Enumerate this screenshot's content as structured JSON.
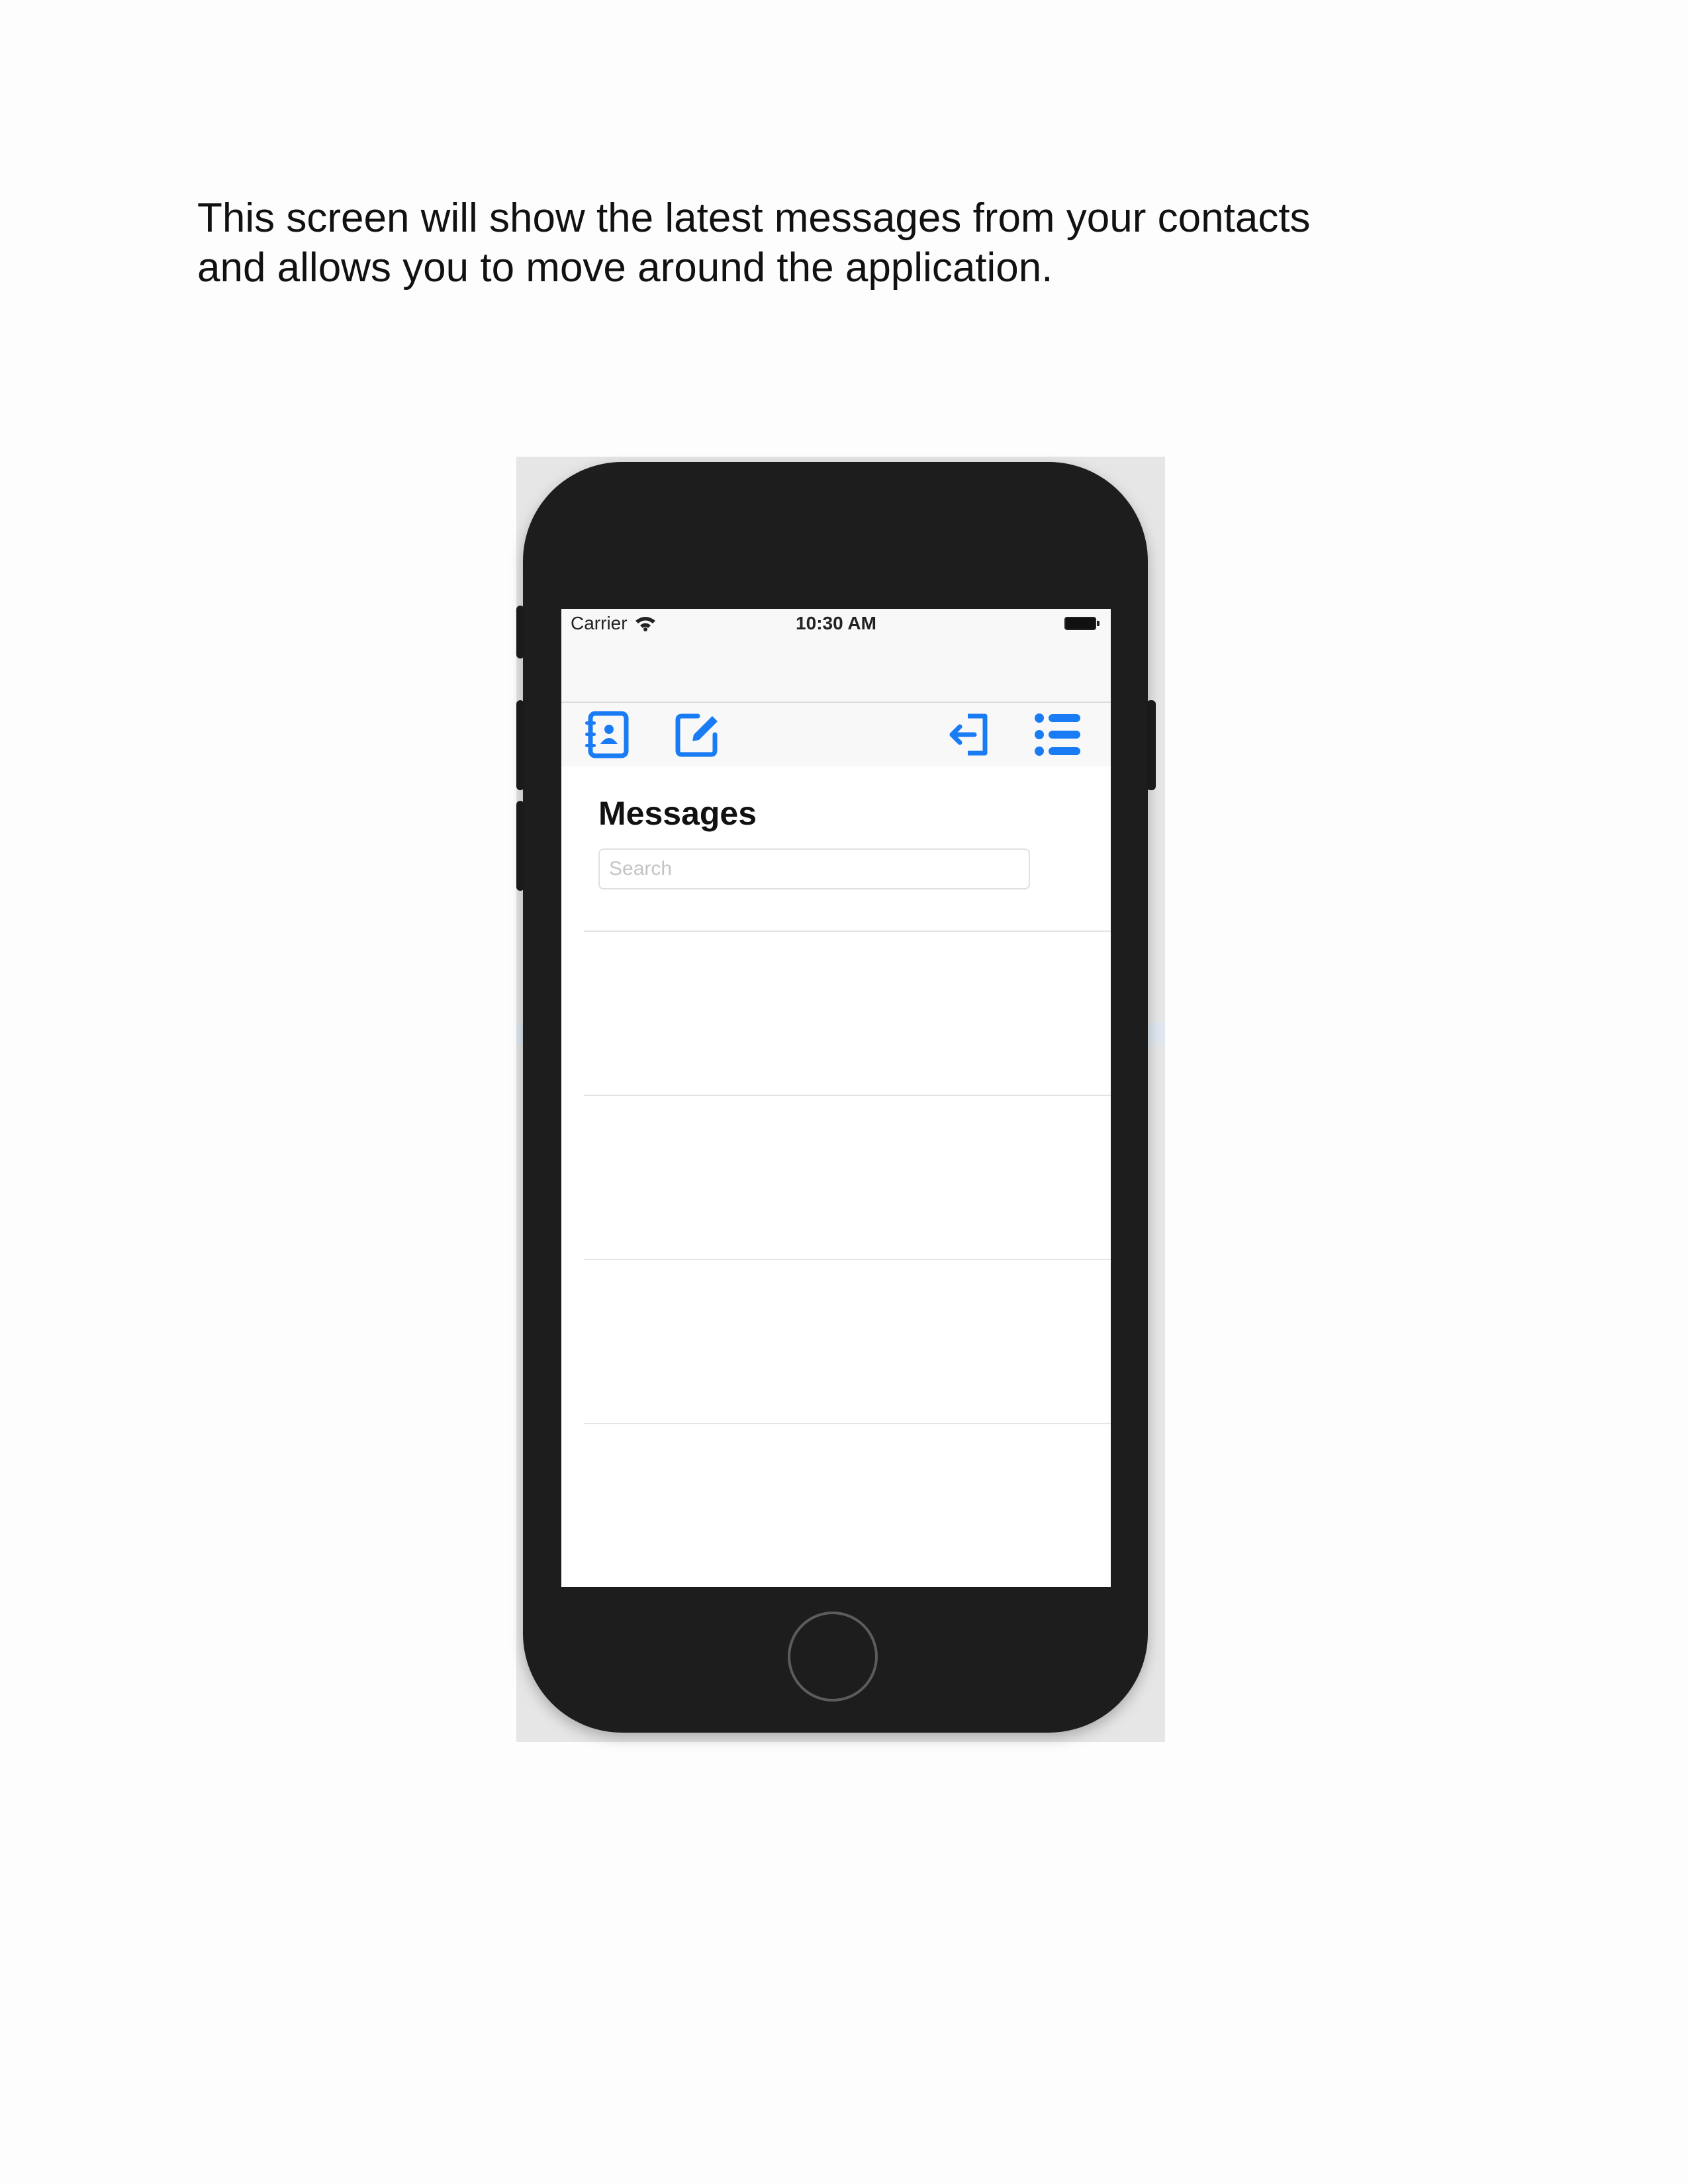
{
  "intro": {
    "line1": "This screen will show the latest messages from your contacts",
    "line2": "and allows you to move around the application."
  },
  "status_bar": {
    "carrier": "Carrier",
    "time": "10:30 AM",
    "battery_level": 1.0
  },
  "toolbar": {
    "left_buttons": [
      "contacts-book-icon",
      "compose-icon"
    ],
    "right_buttons": [
      "logout-icon",
      "list-menu-icon"
    ],
    "accent_color": "#1a7cf5"
  },
  "messages": {
    "title": "Messages",
    "search_placeholder": "Search",
    "rows": []
  },
  "colors": {
    "device_body": "#1d1d1d",
    "screen_background": "#ffffff",
    "bar_background": "#f8f8f8"
  }
}
